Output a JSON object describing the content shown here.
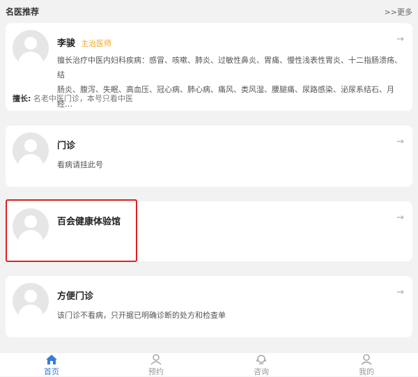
{
  "header": {
    "title": "名医推荐",
    "more": ">>更多"
  },
  "cards": [
    {
      "name": "李骏",
      "role": "主治医师",
      "desc_line1": "擅长治疗中医内妇科疾病：感冒、咳嗽、肺炎、过敏性鼻炎、胃痛、慢性浅表性胃炎、十二指肠溃疡、结",
      "desc_line2": "肠炎、腹泻、失眠、高血压、冠心病、肺心病、痛风、类风湿、腰腿痛、尿路感染、泌尿系结石、月经…",
      "specialty_label": "擅长:",
      "specialty_value": "名老中医门诊，本号只看中医"
    },
    {
      "name": "门诊",
      "desc": "看病请挂此号"
    },
    {
      "name": "百会健康体验馆"
    },
    {
      "name": "方便门诊",
      "desc": "该门诊不看病，只开据已明确诊断的处方和检查单"
    }
  ],
  "arrow": "→",
  "tabs": [
    {
      "label": "首页",
      "icon": "home-icon",
      "active": true
    },
    {
      "label": "预约",
      "icon": "appointment-icon",
      "active": false
    },
    {
      "label": "咨询",
      "icon": "consult-icon",
      "active": false
    },
    {
      "label": "我的",
      "icon": "profile-icon",
      "active": false
    }
  ],
  "colors": {
    "accent": "#3a7bd5",
    "role": "#f5a623",
    "highlight": "#e02020"
  }
}
